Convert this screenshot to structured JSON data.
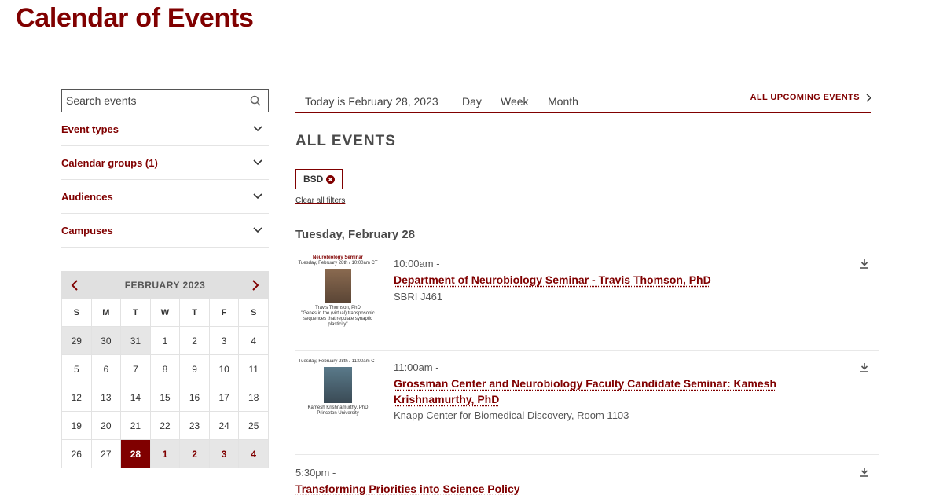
{
  "page": {
    "title": "Calendar of Events"
  },
  "search": {
    "placeholder": "Search events"
  },
  "filters": [
    {
      "label": "Event types"
    },
    {
      "label": "Calendar groups (1)"
    },
    {
      "label": "Audiences"
    },
    {
      "label": "Campuses"
    }
  ],
  "calendar": {
    "month": "FEBRUARY 2023",
    "weekdays": [
      "S",
      "M",
      "T",
      "W",
      "T",
      "F",
      "S"
    ],
    "days": [
      "29",
      "30",
      "31",
      "1",
      "2",
      "3",
      "4",
      "5",
      "6",
      "7",
      "8",
      "9",
      "10",
      "11",
      "12",
      "13",
      "14",
      "15",
      "16",
      "17",
      "18",
      "19",
      "20",
      "21",
      "22",
      "23",
      "24",
      "25",
      "26",
      "27",
      "28",
      "1",
      "2",
      "3",
      "4"
    ],
    "selected": "28"
  },
  "toolbar": {
    "today": "Today is February 28, 2023",
    "views": [
      "Day",
      "Week",
      "Month"
    ],
    "upcoming": "ALL UPCOMING EVENTS"
  },
  "main": {
    "heading": "ALL EVENTS",
    "chip": "BSD",
    "clear": "Clear all filters",
    "date": "Tuesday, February 28"
  },
  "events": [
    {
      "time": "10:00am -",
      "title": "Department of Neurobiology Seminar - Travis Thomson, PhD",
      "location": "SBRI J461",
      "thumb": {
        "heading": "Neurobiology Seminar",
        "subheading": "Tuesday, February 28th / 10:00am CT",
        "name": "Travis Thomson, PhD",
        "caption": "\"Genes in the (virtual) transposonic sequences that regulate synaptic plasticity\""
      }
    },
    {
      "time": "11:00am -",
      "title": "Grossman Center and Neurobiology Faculty Candidate Seminar: Kamesh Krishnamurthy, PhD",
      "location": "Knapp Center for Biomedical Discovery, Room 1103",
      "thumb": {
        "heading": "Tuesday, February 28th / 11:00am CT",
        "subheading": "",
        "name": "Kamesh Krishnamurthy, PhD",
        "caption": "Princeton University"
      }
    },
    {
      "time": "5:30pm -",
      "title": "Transforming Priorities into Science Policy",
      "location": "",
      "thumb": null
    }
  ],
  "colors": {
    "accent": "#800000",
    "selected_day": "#800000",
    "muted_bg": "#e6e6e6"
  }
}
